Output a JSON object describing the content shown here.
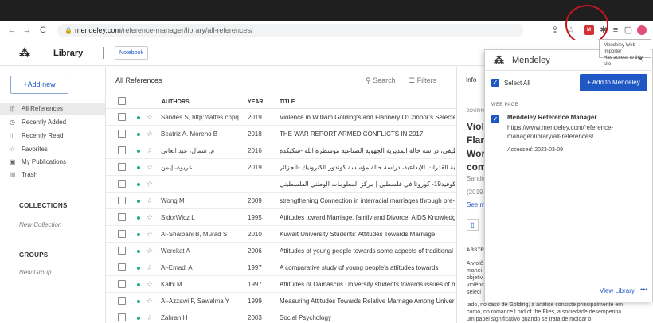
{
  "browser": {
    "url_host": "mendeley.com",
    "url_path": "/reference-manager/library/all-references/",
    "nav_back": "←",
    "nav_forward": "→",
    "reload": "C",
    "ext_mendeley_label": "M",
    "highlight_color": "#c0171f"
  },
  "header": {
    "title": "Library",
    "notebook_label": "Notebook"
  },
  "sidebar": {
    "add_new_label": "+Add new",
    "items": [
      {
        "icon": "||\\",
        "label": "All References",
        "active": true
      },
      {
        "icon": "◷",
        "label": "Recently Added"
      },
      {
        "icon": "▯",
        "label": "Recently Read"
      },
      {
        "icon": "☆",
        "label": "Favorites"
      },
      {
        "icon": "▣",
        "label": "My Publications"
      },
      {
        "icon": "▥",
        "label": "Trash"
      }
    ],
    "collections_heading": "COLLECTIONS",
    "new_collection": "New Collection",
    "groups_heading": "GROUPS",
    "new_group": "New Group"
  },
  "list": {
    "heading": "All References",
    "search_label": "Search",
    "filters_label": "Filters",
    "columns": {
      "authors": "AUTHORS",
      "year": "YEAR",
      "title": "TITLE"
    },
    "rows": [
      {
        "authors": "Sandes S, http://lattes.cnpq...",
        "year": "2019",
        "title": "Violence in William Golding's and Flannery O'Connor's Selected W"
      },
      {
        "authors": "Beatriz A. Moreno B",
        "year": "2018",
        "title": "THE WAR REPORT ARMED CONFLICTS IN 2017"
      },
      {
        "authors": "م. شمال، عبد الغاني",
        "year": "2016",
        "title": "دور التنسيق الإداري في تطوير الأداء الوظيفي، دراسة حالة المديرية الجهوية الصناعية موسطرة الله -سكيكدة"
      },
      {
        "authors": "عريوة، إيمن",
        "year": "2019",
        "title": "دور رأس المال الفكري في تنمية القدرات الإبداعية، دراسة حالة مؤسسة كوندور الكترونيك -الجزائر"
      },
      {
        "authors": "",
        "year": "",
        "title": "دراسة الاتجاهات الوطنية لمواجهة فيروس كوفيد19- كورونا في فلسطين | مركز المعلومات الوطني الفلسطيني"
      },
      {
        "authors": "Wong M",
        "year": "2009",
        "title": "strengthening Connection in interracial marriages through pre-mar"
      },
      {
        "authors": "SidorWicz L",
        "year": "1995",
        "title": "Attitudes toward Marriage, family and Divorce, AIDS Knowledge, ("
      },
      {
        "authors": "Al-Shaibani B, Murad S",
        "year": "2010",
        "title": "Kuwait University Students' Attitudes Towards Marriage"
      },
      {
        "authors": "Werekat A",
        "year": "2006",
        "title": "Attitudes of young people towards some aspects of traditional anc"
      },
      {
        "authors": "Al-Emadi A",
        "year": "1997",
        "title": "A comparative study of young people's attitudes towards"
      },
      {
        "authors": "Kalbi M",
        "year": "1997",
        "title": "Attitudes of Damascus University students towards issues of marr"
      },
      {
        "authors": "Al-Azzawi F, Sawalma Y",
        "year": "1999",
        "title": "Measuring Attitudes Towards Relative Marriage Among University"
      },
      {
        "authors": "Zahran H",
        "year": "2003",
        "title": "Social Psychology"
      }
    ]
  },
  "detail": {
    "tab_label": "Info",
    "journal_label": "JOURN",
    "title_lines": [
      "Viol",
      "Flar",
      "Wor",
      "com"
    ],
    "author_snippet": "Sande",
    "year_snippet": "(2019",
    "see_more": "See m",
    "abstract_heading": "ABSTR",
    "abstract_lines": [
      "A violê",
      "manei",
      "objetiv",
      "violênc",
      "seleci",
      "lado, no caso de Golding, a análise consiste principalmente em",
      "como, no romance Lord of the Flies, a sociedade desempenha",
      "um papel significativo quando se trata de moldar o"
    ]
  },
  "tooltip": {
    "line1": "Mendeley Web Importer",
    "line2": "Has access to this site"
  },
  "popup": {
    "brand": "Mendeley",
    "close": "×",
    "select_all": "Select All",
    "add_button": "+ Add to Mendeley",
    "section": "WEB PAGE",
    "item_title": "Mendeley Reference Manager",
    "item_lines": [
      "https://www.mendeley.com/reference-",
      "manager/library/all-references/"
    ],
    "accessed_label": "Accessed:",
    "accessed_value": " 2023-03-09",
    "view_library": "View Library",
    "more": "•••",
    "accent_color": "#1f58c4"
  }
}
